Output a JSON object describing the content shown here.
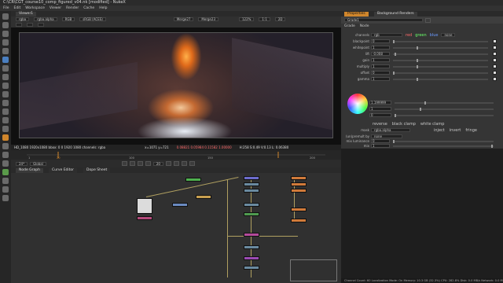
{
  "window": {
    "title": "C:\\CR\\CGT_course10_comp_figured_v04.nk [modified] - NukeX"
  },
  "menu": [
    "File",
    "Edit",
    "Workspace",
    "Viewer",
    "Render",
    "Cache",
    "Help"
  ],
  "viewer": {
    "tab": "Viewer1",
    "channels": "rgba",
    "alpha": "rgba.alpha",
    "colorspace": "RGB",
    "lut": "sRGB (ACES)",
    "input_a": "Merge27",
    "input_b": "Merge23",
    "zoom": "122%",
    "ratio": "1:1",
    "mode": "2D",
    "info_left": "HD_1080 1920x1080  bbox: 0 0 1920 1080 channels: rgba",
    "info_coords": "x=1071 y=721",
    "info_rgb": "0.08821  0.05984  0.11582  1.00000",
    "info_hsv": "H:258 S:0.49 V:0.13  L: 0.06380"
  },
  "timeline": {
    "frame": "20",
    "fps": "24*",
    "scope": "Global",
    "marks": [
      "1",
      "20",
      "100",
      "150",
      "200"
    ]
  },
  "nodegraph": {
    "tabs": [
      "Node Graph",
      "Curve Editor",
      "Dope Sheet"
    ]
  },
  "properties": {
    "tabs": [
      "Properties",
      "Background Renders"
    ],
    "node_name": "Grade1",
    "subtabs": [
      "Grade",
      "Node"
    ],
    "channels_label": "channels",
    "channels_value": "rgb",
    "channel_checks": [
      "red",
      "green",
      "blue",
      "none"
    ],
    "rows": [
      {
        "label": "blackpoint",
        "value": "0"
      },
      {
        "label": "whitepoint",
        "value": "1"
      },
      {
        "label": "lift",
        "value": "-0.008"
      },
      {
        "label": "gain",
        "value": "1"
      },
      {
        "label": "multiply",
        "value": "1"
      },
      {
        "label": "offset",
        "value": "0"
      },
      {
        "label": "gamma",
        "value": "1"
      },
      {
        "label": "",
        "value": "1.199999"
      },
      {
        "label": "",
        "value": "1"
      },
      {
        "label": "",
        "value": "0"
      }
    ],
    "reverse": "reverse",
    "black_clamp": "black clamp",
    "white_clamp": "white clamp",
    "mask_label": "mask",
    "mask_value": "rgba.alpha",
    "inject": "inject",
    "invert": "invert",
    "fringe": "fringe",
    "unpremult_label": "(un)premult by",
    "unpremult_value": "none",
    "mix_lum_label": "mix luminance",
    "mix_lum_value": "0",
    "mix_label": "mix",
    "mix_value": "1"
  },
  "status": "Channel Count: 60  Localization Mode: On  Memory: 10.3 GB (32.3%)  CPU: 282.8%  Disk: 0.0 MB/s  Network: 0.0 MB/s",
  "colors": {
    "accent": "#d0862c",
    "panel": "#353535",
    "viewer_bg": "#101010"
  }
}
